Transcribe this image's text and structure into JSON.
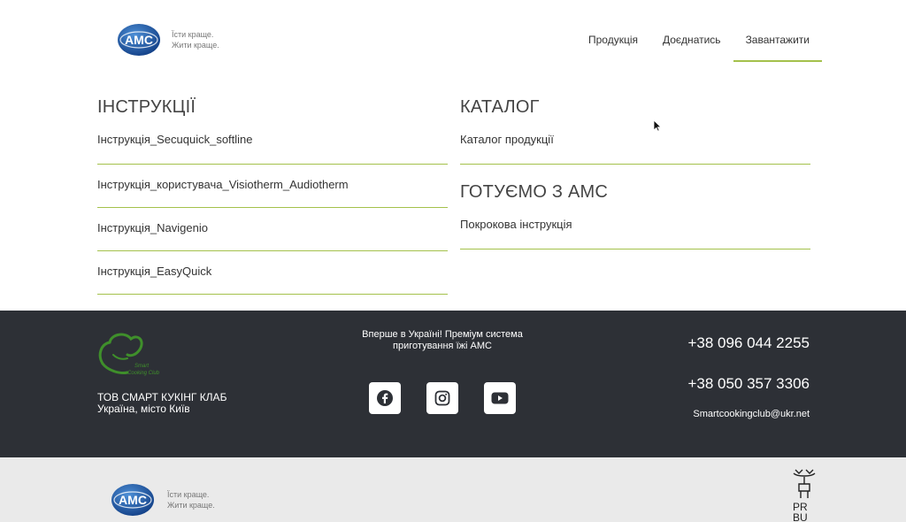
{
  "header": {
    "logo_text": "AMC",
    "tagline_line1": "Їсти краще.",
    "tagline_line2": "Жити краще.",
    "nav": [
      {
        "label": "Продукція"
      },
      {
        "label": "Доєднатись"
      },
      {
        "label": "Завантажити"
      }
    ]
  },
  "instructions": {
    "title": "ІНСТРУКЦІЇ",
    "items": [
      {
        "label": "Інструкція_Secuquick_softline"
      },
      {
        "label": "Інструкція_користувача_Visiotherm_Audiotherm"
      },
      {
        "label": "Інструкція_Navigenio"
      },
      {
        "label": "Інструкція_EasyQuick"
      }
    ]
  },
  "catalog": {
    "title": "КАТАЛОГ",
    "items": [
      {
        "label": "Каталог продукції"
      }
    ]
  },
  "cooking": {
    "title": "ГОТУЄМО З АМС",
    "items": [
      {
        "label": "Покрокова інструкція"
      }
    ]
  },
  "footer": {
    "club_logo_line1": "Smart",
    "club_logo_line2": "Cooking Club",
    "company_line1": "ТОВ  СМАРТ КУКІНГ КЛАБ",
    "company_line2": "Україна, місто Київ",
    "slogan_line1": "Вперше в Україні! Преміум система",
    "slogan_line2": "приготування їжі АМС",
    "phone1": "+38 096 044 2255",
    "phone2": "+38 050 357 3306",
    "email": "Smartcookingclub@ukr.net",
    "socials": [
      "facebook-icon",
      "instagram-icon",
      "youtube-icon"
    ]
  },
  "bottom": {
    "logo_text": "AMC",
    "tagline_line1": "Їсти краще.",
    "tagline_line2": "Жити краще.",
    "prbu_line1": "PR",
    "prbu_line2": "BU"
  },
  "colors": {
    "accent": "#a4c14b",
    "footer_bg": "#2d3036",
    "bottom_bg": "#eaeaea",
    "amc_blue": "#1b5aa6",
    "club_green": "#3f8f2b"
  }
}
